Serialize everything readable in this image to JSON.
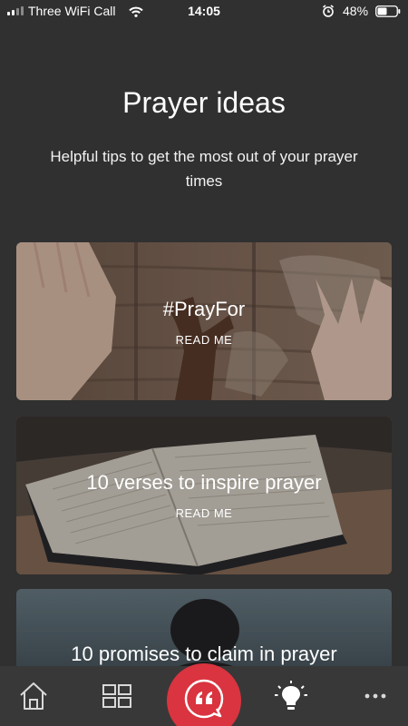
{
  "status_bar": {
    "carrier": "Three WiFi Call",
    "time": "14:05",
    "battery": "48%"
  },
  "header": {
    "title": "Prayer ideas",
    "subtitle": "Helpful tips to get the most out of your prayer times"
  },
  "cards": [
    {
      "title": "#PrayFor",
      "cta": "READ ME"
    },
    {
      "title": "10 verses to inspire prayer",
      "cta": "READ ME"
    },
    {
      "title": "10 promises to claim in prayer"
    }
  ],
  "bottom_nav": {
    "items": [
      {
        "icon": "home-icon"
      },
      {
        "icon": "grid-icon"
      },
      {
        "icon": "quote-icon"
      },
      {
        "icon": "lightbulb-icon"
      },
      {
        "icon": "more-icon"
      }
    ],
    "accent_color": "#d9343f"
  }
}
